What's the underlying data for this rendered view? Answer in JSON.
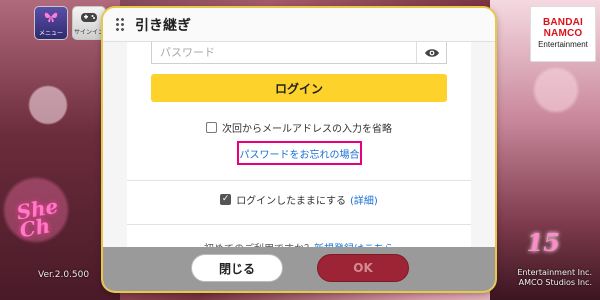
{
  "top_bar": {
    "menu_label": "メニュー",
    "signin_label": "サインイン"
  },
  "logo": {
    "line1": "BANDAI",
    "line2": "NAMCO",
    "line3": "Entertainment"
  },
  "background": {
    "left_sign": "She",
    "left_sign2": "Ch",
    "anniversary": "15"
  },
  "dialog": {
    "title": "引き継ぎ",
    "password_placeholder": "パスワード",
    "login_button": "ログイン",
    "omit_email_label": "次回からメールアドレスの入力を省略",
    "forgot_password_link": "パスワードをお忘れの場合",
    "stay_logged_in_label": "ログインしたままにする",
    "details_link": "(詳細)",
    "first_use_text": "初めてのご利用ですか？",
    "register_link": "新規登録はこちら",
    "close_button": "閉じる",
    "ok_button": "OK"
  },
  "footer": {
    "version": "Ver.2.0.500",
    "copyright_line1": "Entertainment Inc.",
    "copyright_line2": "AMCO Studios Inc."
  },
  "colors": {
    "accent_yellow": "#fcd22b",
    "highlight_pink": "#e6007e",
    "ok_red": "#9c2434",
    "link_blue": "#1a6fd6"
  }
}
